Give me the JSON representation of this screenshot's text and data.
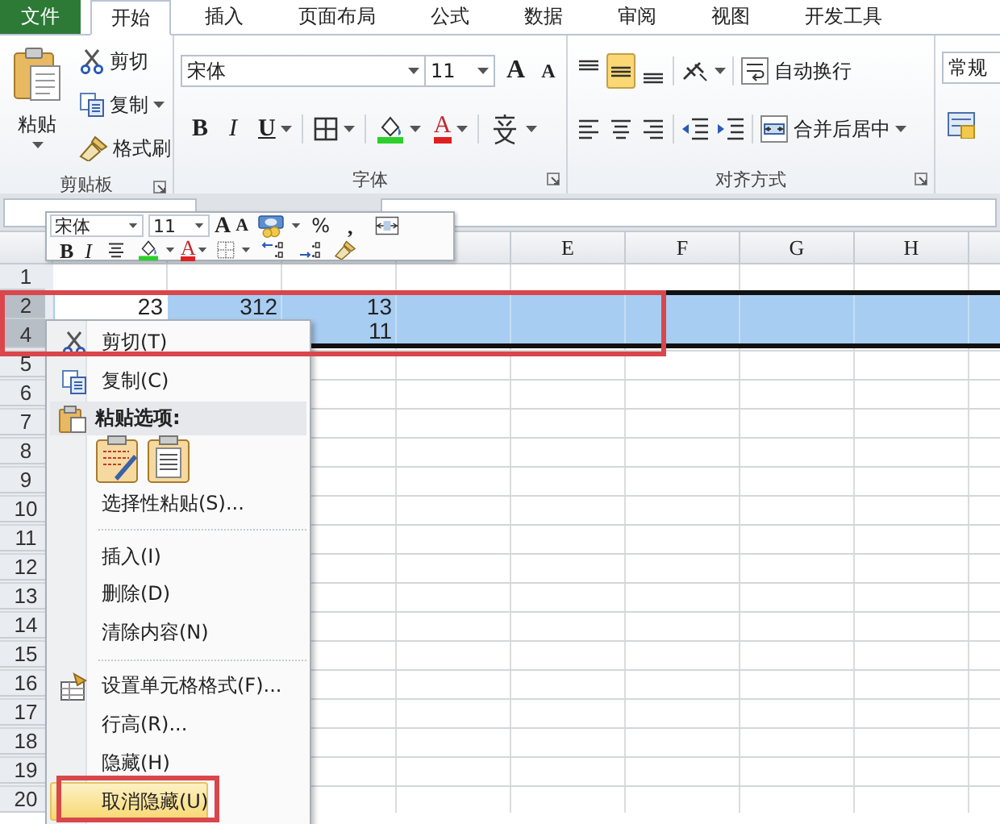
{
  "tabs": [
    {
      "label": "文件",
      "kind": "file",
      "selected": false
    },
    {
      "label": "开始",
      "kind": "tab",
      "selected": true
    },
    {
      "label": "插入",
      "kind": "tab",
      "selected": false
    },
    {
      "label": "页面布局",
      "kind": "tab",
      "selected": false
    },
    {
      "label": "公式",
      "kind": "tab",
      "selected": false
    },
    {
      "label": "数据",
      "kind": "tab",
      "selected": false
    },
    {
      "label": "审阅",
      "kind": "tab",
      "selected": false
    },
    {
      "label": "视图",
      "kind": "tab",
      "selected": false
    },
    {
      "label": "开发工具",
      "kind": "tab",
      "selected": false
    }
  ],
  "clipboard": {
    "title": "剪贴板",
    "paste": "粘贴",
    "cut": "剪切",
    "copy": "复制",
    "format_painter": "格式刷"
  },
  "font": {
    "title": "字体",
    "font_name": "宋体",
    "font_size": "11",
    "grow": "A",
    "shrink": "A",
    "bold": "B",
    "italic": "I",
    "underline": "U",
    "font_color": "A"
  },
  "alignment": {
    "title": "对齐方式",
    "wrap_text": "自动换行",
    "merge_center": "合并后居中",
    "vertical": [
      {
        "selected": false
      },
      {
        "selected": true
      },
      {
        "selected": false
      }
    ]
  },
  "number": {
    "format": "常规"
  },
  "mini_toolbar": {
    "font_name": "宋体",
    "font_size": "11",
    "grow": "A",
    "shrink": "A",
    "percent": "%",
    "comma": ",",
    "bold": "B",
    "italic": "I",
    "font_color": "A"
  },
  "sheet": {
    "visible_columns": [
      "E",
      "F",
      "G",
      "H"
    ],
    "rows": [
      {
        "number": "1",
        "selected": false,
        "cells": []
      },
      {
        "number": "2",
        "selected": true,
        "cells": [
          {
            "value": "23",
            "active": true
          },
          {
            "value": "312",
            "active": false
          },
          {
            "value": "13",
            "active": false
          }
        ]
      },
      {
        "number": "4",
        "selected": true,
        "cells": [
          null,
          null,
          {
            "value": "11",
            "active": false
          }
        ]
      },
      {
        "number": "5",
        "selected": false,
        "cells": []
      },
      {
        "number": "6",
        "selected": false,
        "cells": []
      },
      {
        "number": "7",
        "selected": false,
        "cells": []
      },
      {
        "number": "8",
        "selected": false,
        "cells": []
      },
      {
        "number": "9",
        "selected": false,
        "cells": []
      },
      {
        "number": "10",
        "selected": false,
        "cells": []
      },
      {
        "number": "11",
        "selected": false,
        "cells": []
      },
      {
        "number": "12",
        "selected": false,
        "cells": []
      },
      {
        "number": "13",
        "selected": false,
        "cells": []
      },
      {
        "number": "14",
        "selected": false,
        "cells": []
      },
      {
        "number": "15",
        "selected": false,
        "cells": []
      },
      {
        "number": "16",
        "selected": false,
        "cells": []
      },
      {
        "number": "17",
        "selected": false,
        "cells": []
      },
      {
        "number": "18",
        "selected": false,
        "cells": []
      },
      {
        "number": "19",
        "selected": false,
        "cells": []
      },
      {
        "number": "20",
        "selected": false,
        "cells": []
      }
    ]
  },
  "context_menu": {
    "items": [
      {
        "kind": "cut",
        "label": "剪切(T)",
        "selected": false
      },
      {
        "kind": "copy",
        "label": "复制(C)",
        "selected": false
      },
      {
        "kind": "header",
        "label": "粘贴选项:"
      },
      {
        "kind": "pasteicons"
      },
      {
        "kind": "plain",
        "label": "选择性粘贴(S)...",
        "selected": false
      },
      {
        "kind": "separator"
      },
      {
        "kind": "plain",
        "label": "插入(I)",
        "selected": false
      },
      {
        "kind": "plain",
        "label": "删除(D)",
        "selected": false
      },
      {
        "kind": "plain",
        "label": "清除内容(N)",
        "selected": false
      },
      {
        "kind": "separator"
      },
      {
        "kind": "format",
        "label": "设置单元格格式(F)...",
        "selected": false
      },
      {
        "kind": "plain",
        "label": "行高(R)...",
        "selected": false
      },
      {
        "kind": "plain",
        "label": "隐藏(H)",
        "selected": false
      },
      {
        "kind": "plain",
        "label": "取消隐藏(U)",
        "selected": true
      }
    ]
  }
}
